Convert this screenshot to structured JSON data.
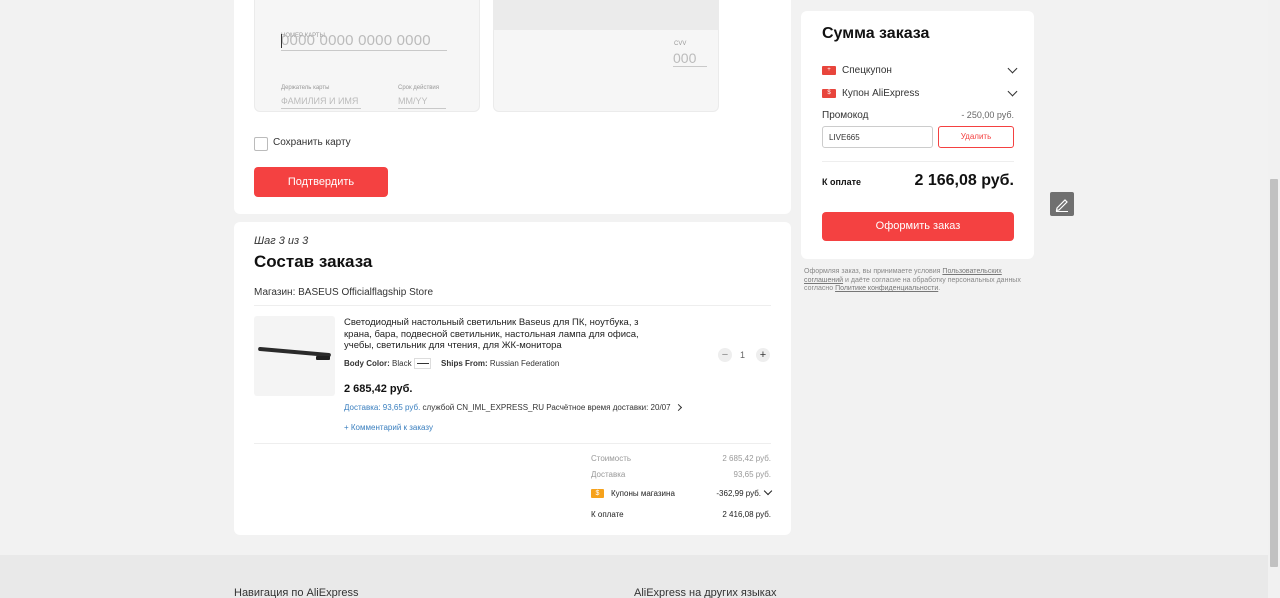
{
  "payment": {
    "card_number_label": "НОМЕР КАРТЫ",
    "card_number_placeholder": "0000 0000 0000 0000",
    "holder_label": "Держатель карты",
    "holder_placeholder": "ФАМИЛИЯ И ИМЯ",
    "expiry_label": "Срок действия",
    "expiry_placeholder": "ММ/YY",
    "cvv_label": "CVV",
    "cvv_placeholder": "000",
    "save_card_label": "Сохранить карту",
    "confirm_label": "Подтвердить"
  },
  "order": {
    "step": "Шаг 3 из 3",
    "title": "Состав заказа",
    "store": "Магазин: BASEUS Officialflagship Store",
    "product": {
      "title": "Светодиодный настольный светильник Baseus для ПК, ноутбука, з крана, бара, подвесной светильник, настольная лампа для офиса, учебы, светильник для чтения, для ЖК-монитора",
      "color_label": "Body Color:",
      "color_value": "Black",
      "ships_label": "Ships From:",
      "ships_value": "Russian Federation",
      "price": "2 685,42 руб.",
      "delivery_link": "Доставка: 93,65 руб.",
      "delivery_service": "службой CN_IML_EXPRESS_RU",
      "delivery_time": "Расчётное время доставки: 20/07",
      "comment": "+ Комментарий к заказу",
      "quantity": "1",
      "minus": "−",
      "plus": "+"
    },
    "totals": {
      "cost_label": "Стоимость",
      "cost_value": "2 685,42 руб.",
      "delivery_label": "Доставка",
      "delivery_value": "93,65 руб.",
      "coupons_label": "Купоны магазина",
      "coupons_value": "-362,99 руб.",
      "pay_label": "К оплате",
      "pay_value": "2 416,08 руб."
    }
  },
  "summary": {
    "title": "Сумма заказа",
    "special_coupon": "Спецкупон",
    "aliexpress_coupon": "Купон AliExpress",
    "promo_label": "Промокод",
    "promo_discount": "- 250,00 руб.",
    "promo_code": "LIVE665",
    "delete_label": "Удалить",
    "pay_label": "К оплате",
    "pay_total": "2 166,08 руб.",
    "place_order_label": "Оформить заказ",
    "coupon_glyph": "$",
    "special_glyph": "+"
  },
  "legal": {
    "text_1": "Оформляя заказ, вы принимаете условия",
    "link_1": "Пользовательских соглашений",
    "text_2": "и даёте согласие на обработку персональных данных согласно",
    "link_2": "Политике конфиденциальности",
    "text_3": "."
  },
  "footer": {
    "nav_title": "Навигация по AliExpress",
    "lang_title": "AliExpress на других языках"
  },
  "colors": {
    "accent": "#f44141",
    "link": "#3a7fbf",
    "coupon": "#f6a21c"
  }
}
